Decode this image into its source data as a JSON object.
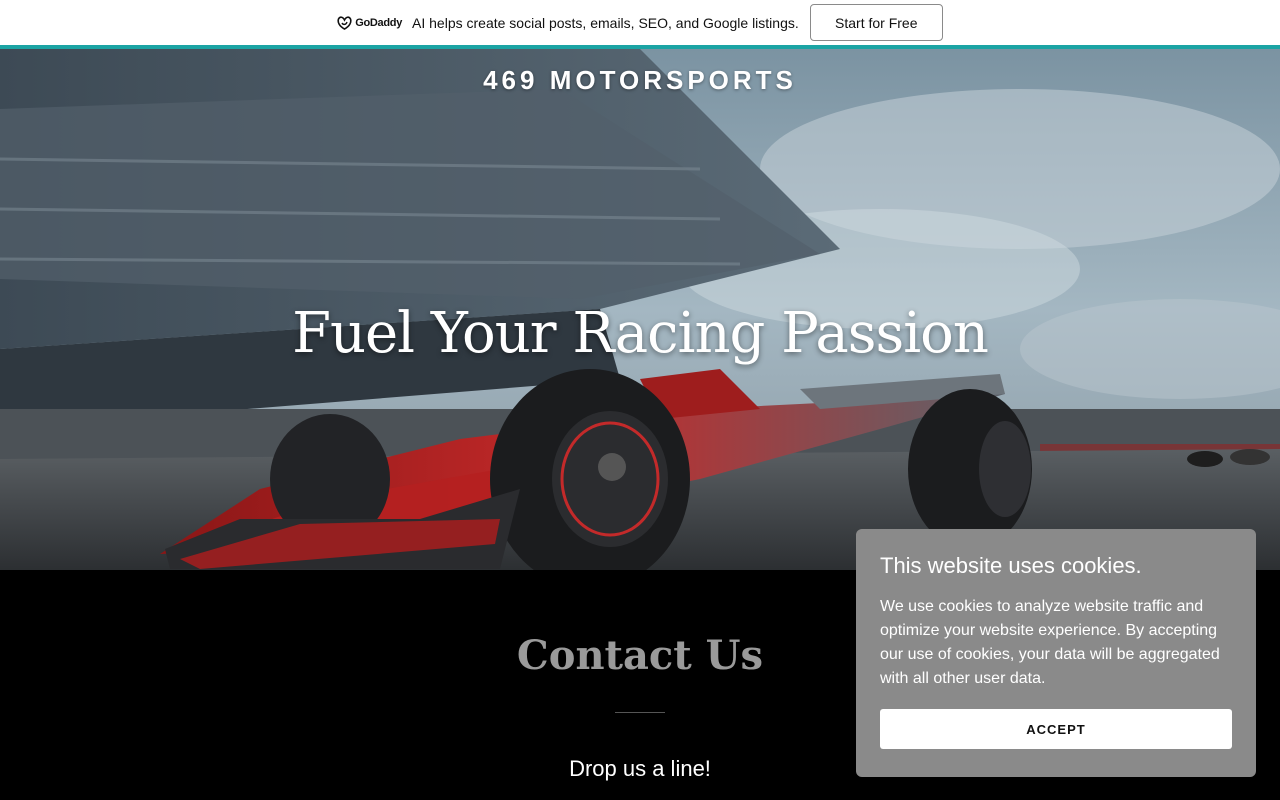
{
  "promo": {
    "logo_text": "GoDaddy",
    "text": "AI helps create social posts, emails, SEO, and Google listings.",
    "button_label": "Start for Free",
    "accent_color": "#1ba4a4"
  },
  "header": {
    "site_title": "469 MOTORSPORTS"
  },
  "hero": {
    "heading": "Fuel Your Racing Passion",
    "image": "race-car-on-track"
  },
  "contact": {
    "title": "Contact Us",
    "subtitle": "Drop us a line!"
  },
  "cookie_banner": {
    "title": "This website uses cookies.",
    "body": "We use cookies to analyze website traffic and optimize your website experience. By accepting our use of cookies, your data will be aggregated with all other user data.",
    "accept_label": "ACCEPT"
  }
}
